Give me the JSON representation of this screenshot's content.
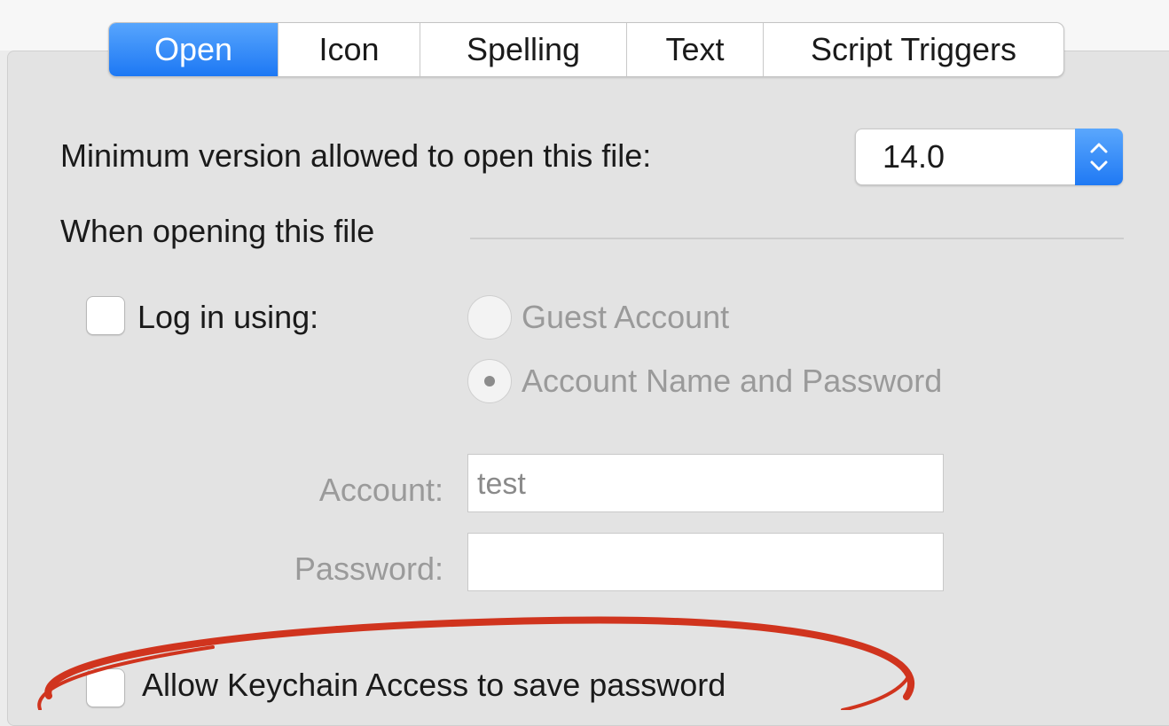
{
  "tabs": [
    "Open",
    "Icon",
    "Spelling",
    "Text",
    "Script Triggers"
  ],
  "active_tab": "Open",
  "min_version_label": "Minimum version allowed to open this file:",
  "min_version_value": "14.0",
  "section_label": "When opening this file",
  "login_label": "Log in using:",
  "login_checked": false,
  "login_options": [
    "Guest Account",
    "Account Name and Password"
  ],
  "login_selected_option": "Account Name and Password",
  "account_label": "Account:",
  "account_value": "test",
  "password_label": "Password:",
  "password_value": "",
  "keychain_label": "Allow Keychain Access to save password",
  "keychain_checked": false,
  "colors": {
    "accent": "#1d78f4",
    "annotation": "#d0341e"
  }
}
